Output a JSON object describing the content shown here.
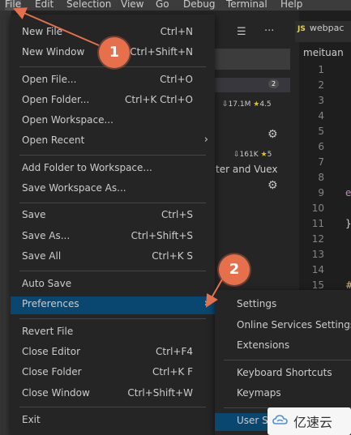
{
  "menubar": {
    "items": [
      "File",
      "Edit",
      "Selection",
      "View",
      "Go",
      "Debug",
      "Terminal",
      "Help"
    ]
  },
  "sidebar": {
    "ext1": {
      "downloads": "17.1M",
      "rating": "4.5",
      "badge": "2"
    },
    "ext2": {
      "downloads": "161K",
      "rating": "5",
      "desc": "ter and Vuex"
    },
    "icons": {
      "list": "list-filter-icon",
      "more": "more-icon",
      "gear": "gear-icon",
      "download": "cloud-download-icon",
      "star": "star-icon"
    }
  },
  "editor": {
    "tab_label": "webpac",
    "tab_badge": "JS",
    "breadcrumb": "meituan",
    "line_numbers": [
      "1",
      "2",
      "3",
      "4",
      "5",
      "6",
      "7",
      "8",
      "9",
      "10",
      "11",
      "12",
      "13",
      "14",
      "15"
    ],
    "visible_code": {
      "l9": "e",
      "l11": "}",
      "l15": "#"
    }
  },
  "file_menu": {
    "items": [
      {
        "label": "New File",
        "shortcut": "Ctrl+N"
      },
      {
        "label": "New Window",
        "shortcut": "Ctrl+Shift+N"
      },
      {
        "label": "Open File...",
        "shortcut": "Ctrl+O"
      },
      {
        "label": "Open Folder...",
        "shortcut": "Ctrl+K Ctrl+O"
      },
      {
        "label": "Open Workspace...",
        "shortcut": ""
      },
      {
        "label": "Open Recent",
        "shortcut": ""
      },
      {
        "label": "Add Folder to Workspace...",
        "shortcut": ""
      },
      {
        "label": "Save Workspace As...",
        "shortcut": ""
      },
      {
        "label": "Save",
        "shortcut": "Ctrl+S"
      },
      {
        "label": "Save As...",
        "shortcut": "Ctrl+Shift+S"
      },
      {
        "label": "Save All",
        "shortcut": "Ctrl+K S"
      },
      {
        "label": "Auto Save",
        "shortcut": ""
      },
      {
        "label": "Preferences",
        "shortcut": ""
      },
      {
        "label": "Revert File",
        "shortcut": ""
      },
      {
        "label": "Close Editor",
        "shortcut": "Ctrl+F4"
      },
      {
        "label": "Close Folder",
        "shortcut": "Ctrl+K F"
      },
      {
        "label": "Close Window",
        "shortcut": "Ctrl+Shift+W"
      },
      {
        "label": "Exit",
        "shortcut": ""
      }
    ],
    "submenu_icon": "chevron-right-icon"
  },
  "preferences_menu": {
    "items": [
      {
        "label": "Settings"
      },
      {
        "label": "Online Services Settings"
      },
      {
        "label": "Extensions"
      },
      {
        "label": "Keyboard Shortcuts"
      },
      {
        "label": "Keymaps"
      },
      {
        "label": "User Sn"
      }
    ]
  },
  "annotations": [
    "1",
    "2"
  ],
  "watermark": {
    "text": "亿速云",
    "icon": "cloud-logo-icon"
  },
  "colors": {
    "menu_bg": "#252526",
    "highlight": "#094771",
    "annotation": "#e6704c",
    "menubar_bg": "#3c3c3c"
  }
}
